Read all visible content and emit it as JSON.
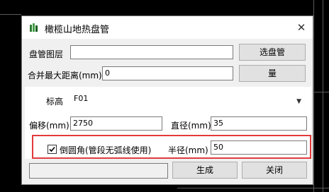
{
  "window": {
    "title": "橄榄山地热盘管",
    "close_glyph": "✕"
  },
  "fields": {
    "pipe_layer_label": "盘管图层",
    "pipe_layer_value": "",
    "select_pipe_label": "选盘管",
    "merge_distance_label": "合并最大距离(mm)",
    "merge_distance_value": "0",
    "measure_label": "量",
    "elevation_label": "标高",
    "elevation_value": "F01",
    "offset_label": "偏移(mm)",
    "offset_value": "2750",
    "diameter_label": "直径(mm)",
    "diameter_value": "35",
    "fillet_label": "倒圆角(管段无弧线使用)",
    "fillet_checked": true,
    "radius_label": "半径(mm)",
    "radius_value": "50",
    "status_value": ""
  },
  "buttons": {
    "generate": "生成",
    "close": "关闭"
  },
  "colors": {
    "highlight": "#e23b3b",
    "dialog_bg": "#f0f0f0"
  }
}
